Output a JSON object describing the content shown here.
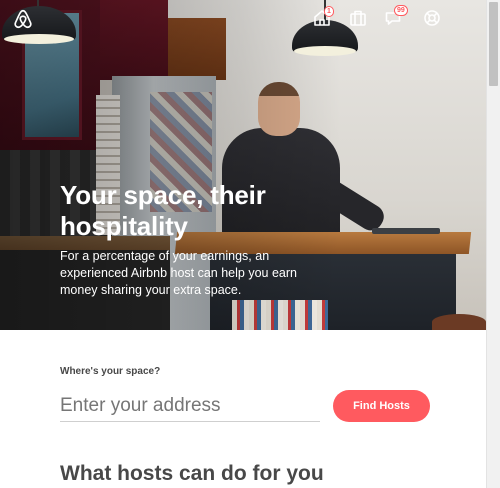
{
  "header": {
    "logo_icon": "airbnb-logo-icon",
    "nav": [
      {
        "name": "host-home-icon",
        "badge": "1"
      },
      {
        "name": "trips-suitcase-icon",
        "badge": ""
      },
      {
        "name": "messages-icon",
        "badge": "99"
      },
      {
        "name": "help-lifebuoy-icon",
        "badge": ""
      }
    ]
  },
  "hero": {
    "title_line1": "Your space, their",
    "title_line2": "hospitality",
    "subtitle_line1": "For a percentage of your earnings, an",
    "subtitle_line2": "experienced Airbnb host can help you earn",
    "subtitle_line3": "money sharing your extra space."
  },
  "form": {
    "label": "Where's your space?",
    "address_placeholder": "Enter your address",
    "address_value": "",
    "submit_label": "Find Hosts"
  },
  "section": {
    "title": "What hosts can do for you"
  },
  "colors": {
    "accent": "#ff5a5f",
    "text": "#484848",
    "label": "#767676"
  }
}
